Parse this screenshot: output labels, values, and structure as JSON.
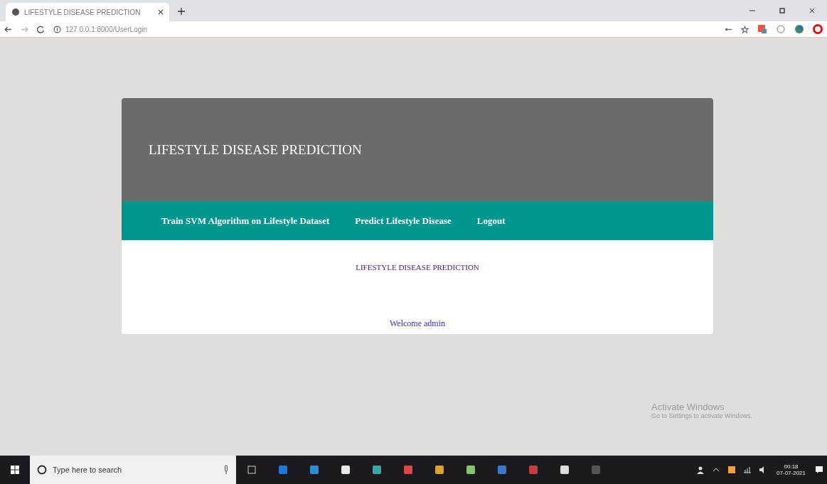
{
  "browser": {
    "tab_title": "LIFESTYLE DISEASE PREDICTION",
    "url": "127.0.0.1:8000/UserLogin"
  },
  "site": {
    "title": "LIFESTYLE DISEASE PREDICTION",
    "nav": [
      "Train SVM Algorithm on Lifestyle Dataset",
      "Predict Lifestyle Disease",
      "Logout"
    ],
    "heading": "LIFESTYLE DISEASE PREDICTION",
    "welcome": "Welcome admin"
  },
  "activation": {
    "title": "Activate Windows",
    "subtitle": "Go to Settings to activate Windows."
  },
  "taskbar": {
    "search_placeholder": "Type here to search",
    "time": "00:18",
    "date": "07-07-2021"
  }
}
